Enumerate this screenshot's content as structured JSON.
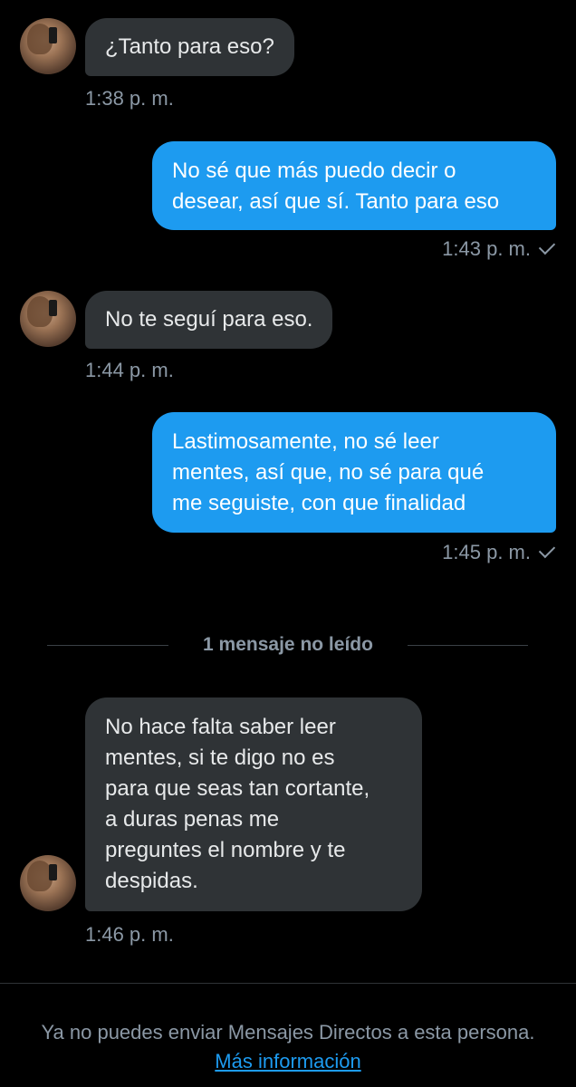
{
  "messages": [
    {
      "text": "¿Tanto para eso?",
      "time": "1:38 p. m."
    },
    {
      "text": "No sé que más puedo decir o\ndesear, así que sí. Tanto para eso",
      "time": "1:43 p. m."
    },
    {
      "text": "No te seguí para eso.",
      "time": "1:44 p. m."
    },
    {
      "text": "Lastimosamente, no sé leer\nmentes, así que, no sé para qué\nme seguiste, con que finalidad",
      "time": "1:45 p. m."
    },
    {
      "text": "No hace falta saber leer\nmentes, si te digo no es\npara que seas tan cortante,\na duras penas me\npreguntes el nombre y te\ndespidas.",
      "time": "1:46 p. m."
    }
  ],
  "unread_divider": "1 mensaje no leído",
  "footer": {
    "text": "Ya no puedes enviar Mensajes Directos a esta persona.",
    "link": "Más información"
  },
  "colors": {
    "background": "#000000",
    "incoming_bubble": "#2f3336",
    "outgoing_bubble": "#1d9bf0",
    "muted_text": "#8b98a5",
    "link": "#1d9bf0"
  }
}
